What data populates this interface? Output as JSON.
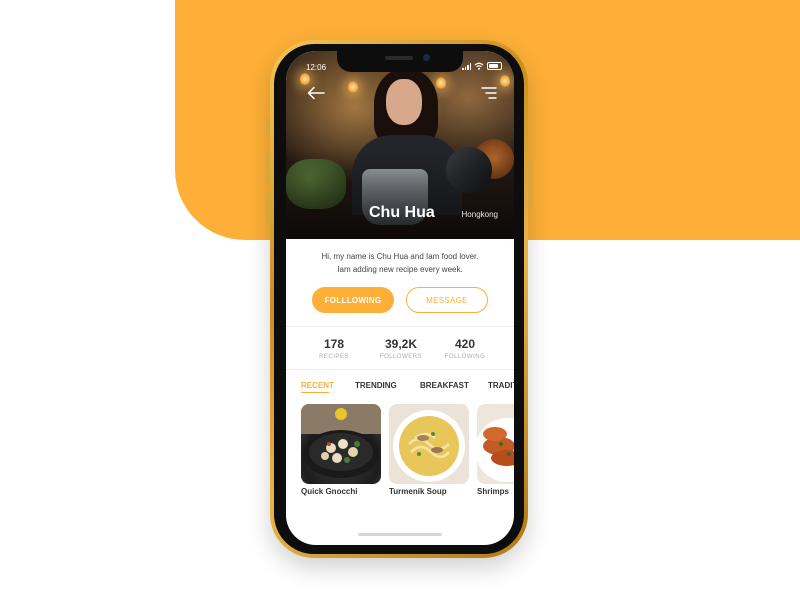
{
  "colors": {
    "accent": "#FDAF37",
    "phone_frame": "#d9a53a",
    "text_dark": "#333333",
    "text_muted": "#aaaaaa"
  },
  "status_bar": {
    "time": "12:06",
    "icons": [
      "cellular-signal-icon",
      "wifi-icon",
      "battery-icon"
    ]
  },
  "header": {
    "back_icon": "arrow-left-icon",
    "menu_icon": "menu-icon"
  },
  "profile": {
    "name": "Chu Hua",
    "location": "Hongkong",
    "bio_line1": "Hi, my name is Chu Hua and Iam food lover.",
    "bio_line2": "Iam adding new recipe every week."
  },
  "actions": {
    "follow_label": "FOLLLOWING",
    "message_label": "MESSAGE"
  },
  "stats": [
    {
      "value": "178",
      "label": "RECIPES"
    },
    {
      "value": "39,2K",
      "label": "FOLLOWERS"
    },
    {
      "value": "420",
      "label": "FOLLOWING"
    }
  ],
  "tabs": [
    {
      "label": "RECENT",
      "active": true
    },
    {
      "label": "TRENDING",
      "active": false
    },
    {
      "label": "BREAKFAST",
      "active": false
    },
    {
      "label": "TRADITIONAL",
      "active": false
    }
  ],
  "recipes": [
    {
      "title": "Quick Gnocchi"
    },
    {
      "title": "Turmenik Soup"
    },
    {
      "title": "Shrimps"
    }
  ]
}
